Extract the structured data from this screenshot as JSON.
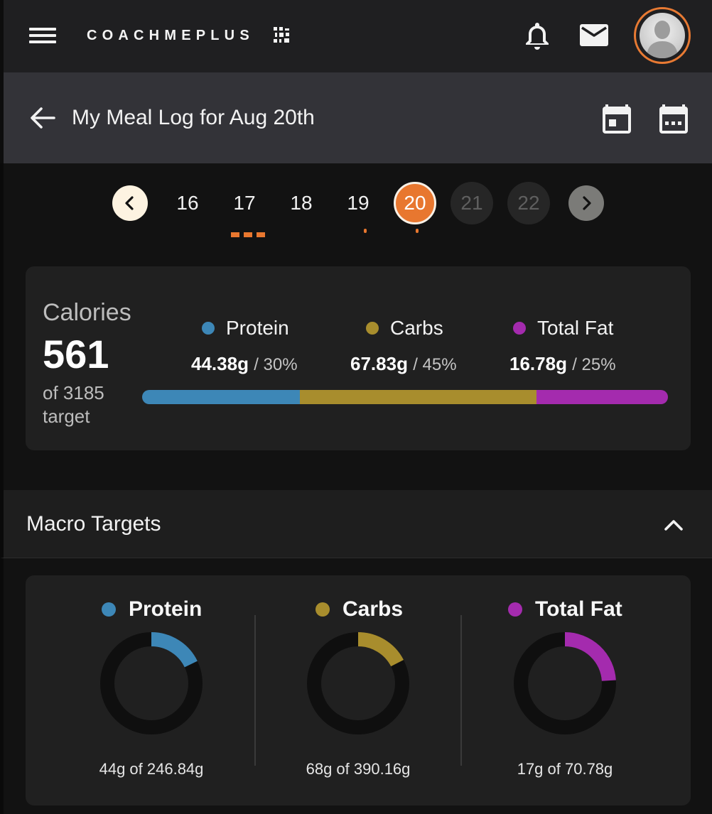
{
  "app": {
    "brand": "COACHMEPLUS",
    "icons": {
      "menu": "hamburger-menu-icon",
      "notifications": "bell-icon",
      "messages": "envelope-icon",
      "profile": "avatar"
    }
  },
  "header": {
    "title": "My Meal Log for Aug 20th"
  },
  "day_strip": {
    "days": [
      "16",
      "17",
      "18",
      "19",
      "20",
      "21",
      "22"
    ],
    "selected": "20"
  },
  "calories": {
    "label": "Calories",
    "value": "561",
    "target_text": "of 3185 target",
    "macros": [
      {
        "name": "Protein",
        "grams": "44.38g",
        "percent": "/ 30%",
        "color": "#3d87b7",
        "share": 0.3
      },
      {
        "name": "Carbs",
        "grams": "67.83g",
        "percent": "/ 45%",
        "color": "#a88d2d",
        "share": 0.45
      },
      {
        "name": "Total Fat",
        "grams": "16.78g",
        "percent": "/ 25%",
        "color": "#a42bae",
        "share": 0.25
      }
    ]
  },
  "macro_targets": {
    "title": "Macro Targets",
    "items": [
      {
        "name": "Protein",
        "summary": "44g of 246.84g",
        "consumed": 44,
        "target": 246.84,
        "color": "#3d87b7"
      },
      {
        "name": "Carbs",
        "summary": "68g of 390.16g",
        "consumed": 68,
        "target": 390.16,
        "color": "#a88d2d"
      },
      {
        "name": "Total Fat",
        "summary": "17g of 70.78g",
        "consumed": 17,
        "target": 70.78,
        "color": "#a42bae"
      }
    ]
  },
  "colors": {
    "accent": "#e8772f",
    "background": "#121212",
    "card": "#202020"
  }
}
